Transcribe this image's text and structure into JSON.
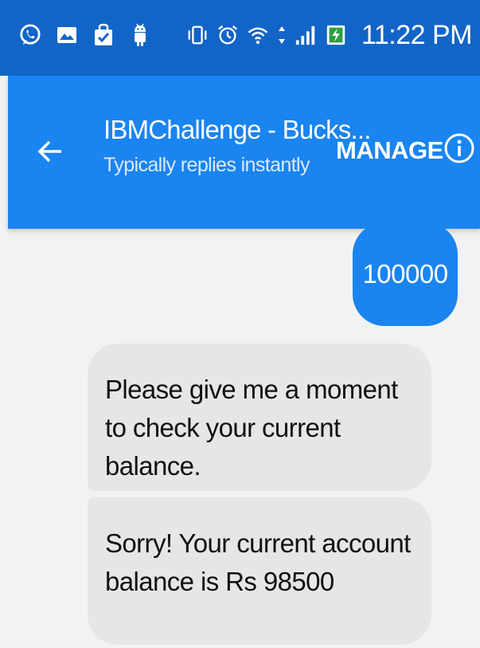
{
  "status_bar": {
    "time": "11:22 PM",
    "left_icons": [
      "whatsapp-icon",
      "gallery-icon",
      "shopping-bag-icon",
      "android-icon"
    ],
    "right_icons": [
      "vibrate-icon",
      "alarm-icon",
      "wifi-icon",
      "data-arrows-icon",
      "signal-icon",
      "battery-charging-icon"
    ]
  },
  "app_bar": {
    "title": "IBMChallenge - Bucks...",
    "subtitle": "Typically replies instantly",
    "manage_label": "MANAGE",
    "back_icon": "back-arrow-icon",
    "info_icon": "info-icon"
  },
  "messages": [
    {
      "direction": "outgoing",
      "text": "100000"
    },
    {
      "direction": "incoming",
      "text": "Please give me a moment to check your current balance."
    },
    {
      "direction": "incoming",
      "text": "Sorry! Your current account balance is Rs 98500"
    }
  ],
  "colors": {
    "status_bar": "#1265c7",
    "app_bar": "#1a84f0",
    "outgoing_bubble": "#1a84f0",
    "incoming_bubble": "#e6e6e6",
    "background": "#f2f2f2"
  }
}
